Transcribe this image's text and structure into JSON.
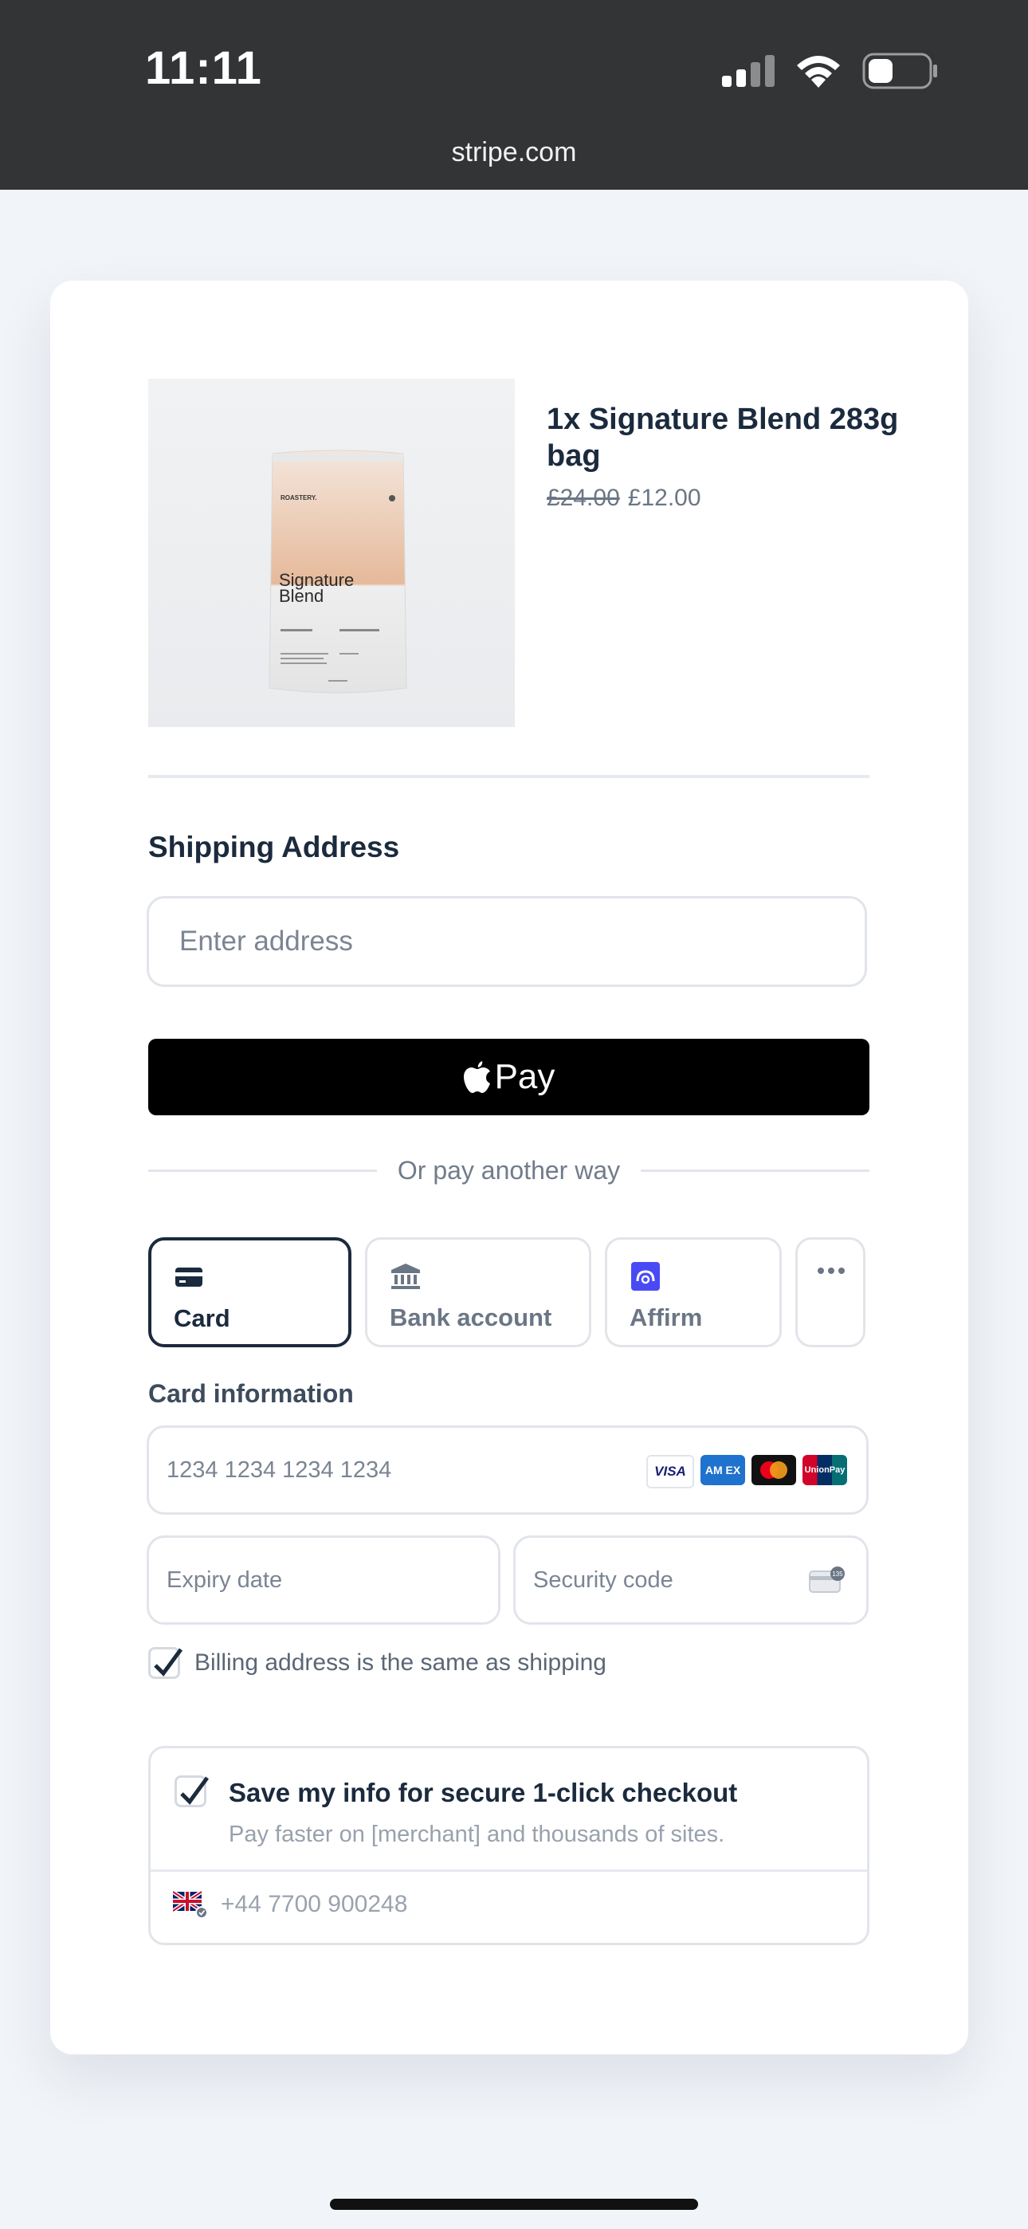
{
  "status_bar": {
    "time": "11:11",
    "url": "stripe.com"
  },
  "product": {
    "title": "1x Signature Blend 283g bag",
    "price_original": "£24.00",
    "price_current": "£12.00",
    "bag_brand": "ROASTERY.",
    "bag_name": "Signature Blend"
  },
  "shipping": {
    "title": "Shipping Address",
    "address_placeholder": "Enter address"
  },
  "apple_pay": {
    "label": "Pay"
  },
  "divider_text": "Or pay another way",
  "payment_methods": [
    {
      "label": "Card",
      "icon": "credit-card-icon",
      "active": true
    },
    {
      "label": "Bank account",
      "icon": "bank-icon",
      "active": false
    },
    {
      "label": "Affirm",
      "icon": "affirm-icon",
      "active": false
    },
    {
      "label": "",
      "icon": "more-icon",
      "active": false
    }
  ],
  "card": {
    "label": "Card information",
    "number_placeholder": "1234 1234 1234 1234",
    "expiry_placeholder": "Expiry date",
    "cvc_placeholder": "Security code",
    "brands": [
      "visa-logo",
      "amex-logo",
      "mastercard-logo",
      "unionpay-logo"
    ],
    "cvc_badge": "135"
  },
  "billing": {
    "checked": true,
    "label": "Billing address is the same as shipping"
  },
  "link": {
    "checked": true,
    "title": "Save my info for secure 1-click checkout",
    "subtitle": "Pay faster on [merchant] and thousands of sites.",
    "phone_placeholder": "+44 7700 900248",
    "flag": "uk-flag-icon"
  },
  "colors": {
    "status_bar_bg": "#323436",
    "page_bg": "#f1f4f8",
    "text_primary": "#1b2a3d",
    "apple_pay_bg": "#000000",
    "affirm": "#4a4af4"
  }
}
